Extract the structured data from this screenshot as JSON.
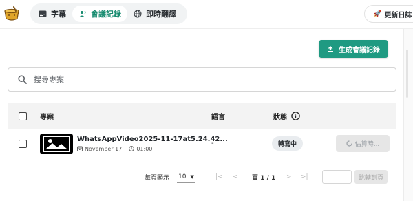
{
  "header": {
    "tabs": [
      {
        "label": "字幕",
        "icon": "subtitle-icon",
        "active": false
      },
      {
        "label": "會議記錄",
        "icon": "microphone-person-icon",
        "active": true
      },
      {
        "label": "即時翻譯",
        "icon": "globe-icon",
        "active": false
      }
    ],
    "changelog_label": "更新日誌",
    "changelog_icon": "rocket-icon"
  },
  "actions": {
    "generate_label": "生成會議記錄",
    "generate_icon": "upload-icon"
  },
  "search": {
    "placeholder": "搜尋專案"
  },
  "table": {
    "columns": {
      "project": "專案",
      "language": "語言",
      "status": "狀態"
    },
    "rows": [
      {
        "name": "WhatsAppVideo2025-11-17at5.24.42...",
        "date": "November 17",
        "duration": "01:00",
        "language": "-",
        "status": "轉寫中",
        "action_label": "估算時..."
      }
    ]
  },
  "pagination": {
    "per_page_label": "每頁顯示",
    "per_page_value": "10",
    "page_label": "頁 1 / 1",
    "jump_label": "跳轉到頁"
  },
  "colors": {
    "accent": "#1f9a82",
    "active_tab_text": "#168b6f"
  }
}
